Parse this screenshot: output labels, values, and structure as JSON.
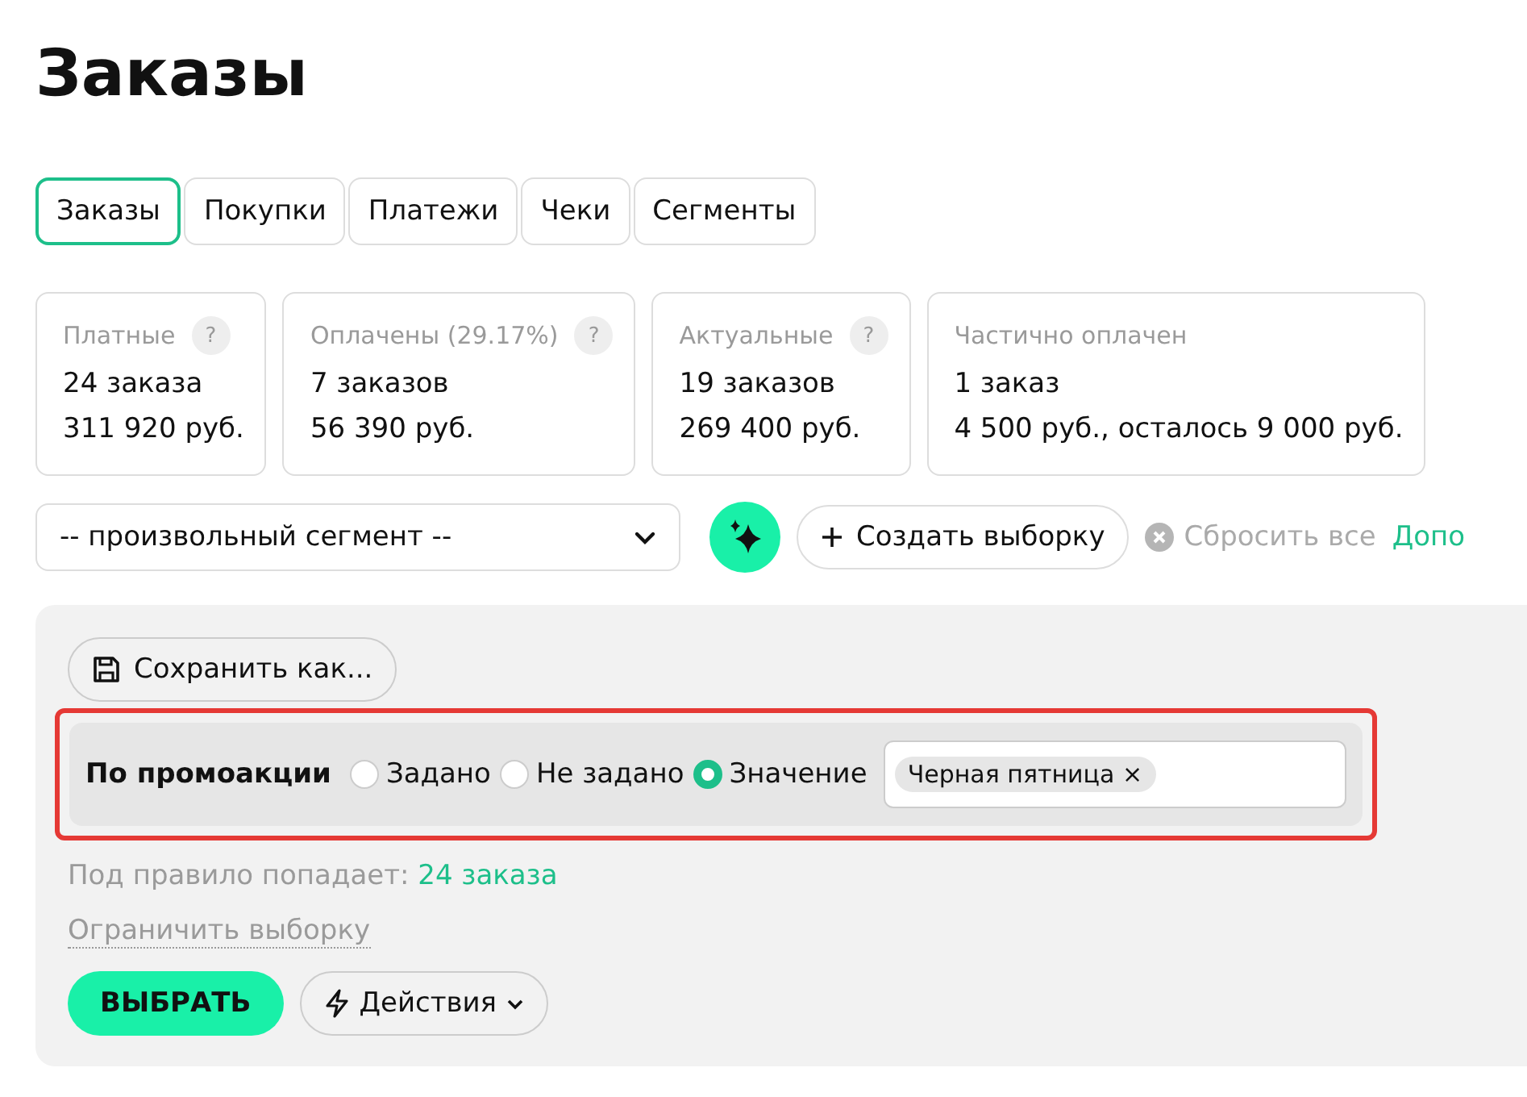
{
  "title": "Заказы",
  "tabs": [
    {
      "label": "Заказы",
      "selected": true
    },
    {
      "label": "Покупки",
      "selected": false
    },
    {
      "label": "Платежи",
      "selected": false
    },
    {
      "label": "Чеки",
      "selected": false
    },
    {
      "label": "Сегменты",
      "selected": false
    }
  ],
  "stats": [
    {
      "label": "Платные",
      "help": "?",
      "lines": [
        "24 заказа",
        "311 920 руб."
      ]
    },
    {
      "label": "Оплачены (29.17%)",
      "help": "?",
      "lines": [
        "7 заказов",
        "56 390 руб."
      ]
    },
    {
      "label": "Актуальные",
      "help": "?",
      "lines": [
        "19 заказов",
        "269 400 руб."
      ]
    },
    {
      "label": "Частично оплачен",
      "lines": [
        "1 заказ",
        "4 500 руб., осталось 9 000 руб."
      ]
    }
  ],
  "toolbar": {
    "segment_select": {
      "value": "-- произвольный сегмент --"
    },
    "create_button": "Создать выборку",
    "reset_button": "Сбросить все",
    "extra_link": "Допо"
  },
  "filter_panel": {
    "save_button": "Сохранить как...",
    "rule": {
      "highlighted": true,
      "label": "По промоакции",
      "options": [
        {
          "label": "Задано",
          "selected": false
        },
        {
          "label": "Не задано",
          "selected": false
        },
        {
          "label": "Значение",
          "selected": true
        }
      ],
      "tags": [
        {
          "label": "Черная пятница",
          "remove": "×"
        }
      ]
    },
    "match_text": "Под правило попадает:",
    "match_link": "24 заказа",
    "limit_link": "Ограничить выборку",
    "select_button": "ВЫБРАТЬ",
    "actions_button": "Действия"
  }
}
